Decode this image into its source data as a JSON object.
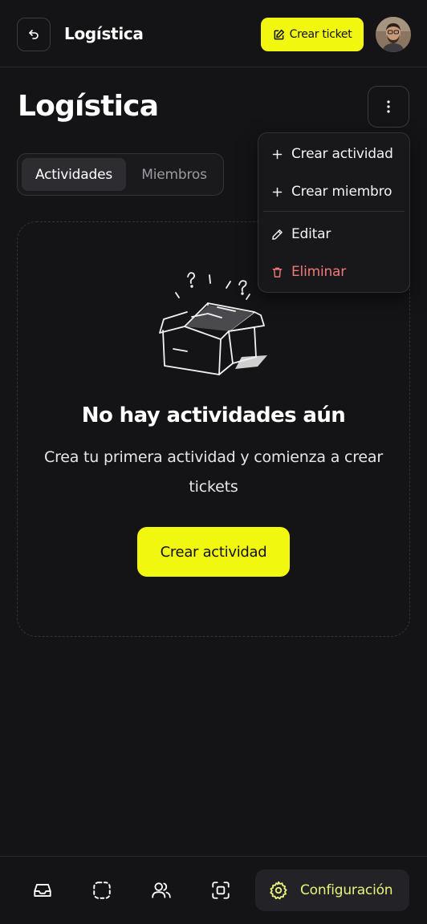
{
  "header": {
    "back_icon": "undo-arrow-icon",
    "title": "Logística",
    "create_ticket_label": "Crear ticket",
    "create_ticket_icon": "edit-square-icon",
    "avatar_icon": "user-avatar"
  },
  "page": {
    "title": "Logística",
    "more_icon": "more-vertical-icon"
  },
  "tabs": [
    {
      "label": "Actividades",
      "active": true
    },
    {
      "label": "Miembros",
      "active": false
    }
  ],
  "empty_state": {
    "illustration": "open-box-illustration",
    "title": "No hay actividades aún",
    "description": "Crea tu primera actividad y comienza a crear tickets",
    "button_label": "Crear actividad"
  },
  "menu": {
    "items": [
      {
        "label": "Crear actividad",
        "icon": "plus-icon"
      },
      {
        "label": "Crear miembro",
        "icon": "plus-icon"
      },
      {
        "label": "Editar",
        "icon": "pencil-icon"
      },
      {
        "label": "Eliminar",
        "icon": "trash-icon",
        "danger": true
      }
    ]
  },
  "bottom_nav": {
    "items": [
      {
        "icon": "inbox-icon"
      },
      {
        "icon": "dashed-square-icon"
      },
      {
        "icon": "users-icon"
      },
      {
        "icon": "scan-square-icon"
      }
    ],
    "active": {
      "label": "Configuración",
      "icon": "gear-icon"
    }
  },
  "colors": {
    "background": "#141416",
    "accent": "#f2f70f",
    "danger": "#f07a7a",
    "active_nav_text": "#e9f27a"
  }
}
